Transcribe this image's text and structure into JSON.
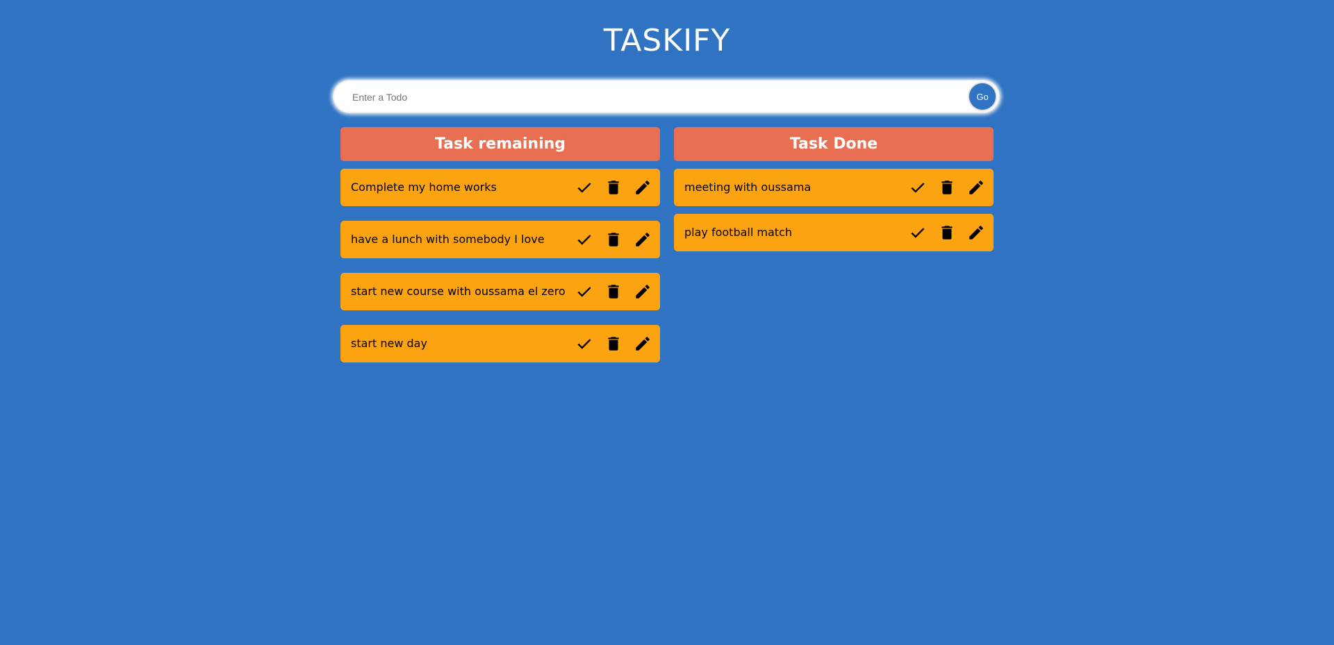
{
  "app": {
    "title": "TASKIFY"
  },
  "input": {
    "placeholder": "Enter a Todo",
    "value": "",
    "go_label": "Go"
  },
  "remaining": {
    "header": "Task remaining",
    "tasks": [
      {
        "text": "Complete my home works"
      },
      {
        "text": "have a lunch with somebody I love"
      },
      {
        "text": "start new course with oussama el zero"
      },
      {
        "text": "start new day"
      }
    ]
  },
  "done": {
    "header": "Task Done",
    "tasks": [
      {
        "text": "meeting with oussama"
      },
      {
        "text": "play football match"
      }
    ]
  },
  "icons": [
    "check-icon",
    "trash-icon",
    "pencil-icon"
  ],
  "colors": {
    "background": "#2f73c2",
    "header": "#e86f51",
    "task": "#fca311",
    "text_light": "#ffffff",
    "text_dark": "#000000"
  }
}
